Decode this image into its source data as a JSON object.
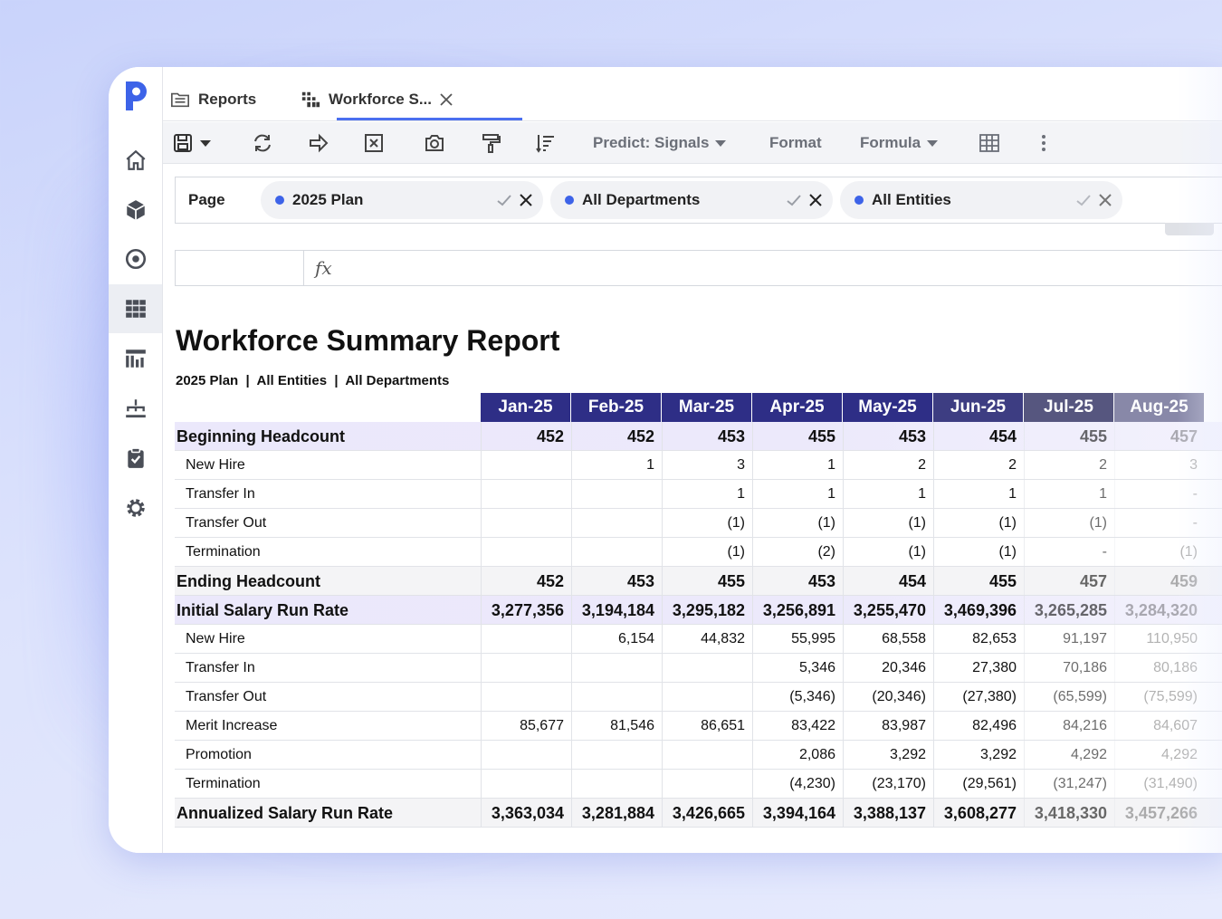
{
  "tabs": {
    "reports_label": "Reports",
    "active_label": "Workforce S...",
    "active_icon": "tree-bars-icon"
  },
  "toolbar": {
    "predict_label": "Predict: Signals",
    "format_label": "Format",
    "formula_label": "Formula"
  },
  "page_filter": {
    "label": "Page",
    "chips": [
      "2025 Plan",
      "All Departments",
      "All Entities"
    ]
  },
  "formula_bar": {
    "fx_label": "fx"
  },
  "report": {
    "title": "Workforce Summary Report",
    "subtitle": "2025 Plan  |  All Entities  |  All Departments",
    "columns": [
      "Jan-25",
      "Feb-25",
      "Mar-25",
      "Apr-25",
      "May-25",
      "Jun-25",
      "Jul-25",
      "Aug-25"
    ],
    "column_colors": [
      "#2e2e86",
      "#2e2e86",
      "#2e2e86",
      "#2e2e86",
      "#2e2e86",
      "#3d3d82",
      "#56567f",
      "#8888a8"
    ],
    "rows": [
      {
        "label": "Beginning Headcount",
        "style": "purple-bold",
        "values": [
          "452",
          "452",
          "453",
          "455",
          "453",
          "454",
          "455",
          "457"
        ]
      },
      {
        "label": "New Hire",
        "style": "plain",
        "values": [
          "",
          "1",
          "3",
          "1",
          "2",
          "2",
          "2",
          "3"
        ]
      },
      {
        "label": "Transfer In",
        "style": "plain",
        "values": [
          "",
          "",
          "1",
          "1",
          "1",
          "1",
          "1",
          "-"
        ]
      },
      {
        "label": "Transfer Out",
        "style": "plain",
        "values": [
          "",
          "",
          "(1)",
          "(1)",
          "(1)",
          "(1)",
          "(1)",
          "-"
        ]
      },
      {
        "label": "Termination",
        "style": "plain",
        "values": [
          "",
          "",
          "(1)",
          "(2)",
          "(1)",
          "(1)",
          "-",
          "(1)"
        ]
      },
      {
        "label": "Ending Headcount",
        "style": "grey-bold",
        "values": [
          "452",
          "453",
          "455",
          "453",
          "454",
          "455",
          "457",
          "459"
        ]
      },
      {
        "label": "Initial Salary Run Rate",
        "style": "purple-bold",
        "values": [
          "3,277,356",
          "3,194,184",
          "3,295,182",
          "3,256,891",
          "3,255,470",
          "3,469,396",
          "3,265,285",
          "3,284,320"
        ]
      },
      {
        "label": "New Hire",
        "style": "plain",
        "values": [
          "",
          "6,154",
          "44,832",
          "55,995",
          "68,558",
          "82,653",
          "91,197",
          "110,950"
        ]
      },
      {
        "label": "Transfer In",
        "style": "plain",
        "values": [
          "",
          "",
          "",
          "5,346",
          "20,346",
          "27,380",
          "70,186",
          "80,186"
        ]
      },
      {
        "label": "Transfer Out",
        "style": "plain",
        "values": [
          "",
          "",
          "",
          "(5,346)",
          "(20,346)",
          "(27,380)",
          "(65,599)",
          "(75,599)"
        ]
      },
      {
        "label": "Merit Increase",
        "style": "plain",
        "values": [
          "85,677",
          "81,546",
          "86,651",
          "83,422",
          "83,987",
          "82,496",
          "84,216",
          "84,607"
        ]
      },
      {
        "label": "Promotion",
        "style": "plain",
        "values": [
          "",
          "",
          "",
          "2,086",
          "3,292",
          "3,292",
          "4,292",
          "4,292"
        ]
      },
      {
        "label": "Termination",
        "style": "plain",
        "values": [
          "",
          "",
          "",
          "(4,230)",
          "(23,170)",
          "(29,561)",
          "(31,247)",
          "(31,490)"
        ]
      },
      {
        "label": "Annualized Salary Run Rate",
        "style": "grey-bold",
        "values": [
          "3,363,034",
          "3,281,884",
          "3,426,665",
          "3,394,164",
          "3,388,137",
          "3,608,277",
          "3,418,330",
          "3,457,266"
        ]
      }
    ]
  },
  "colors": {
    "accent": "#4a6ff0",
    "header_dark": "#2e2e86",
    "chip_dot": "#3d63e8"
  }
}
